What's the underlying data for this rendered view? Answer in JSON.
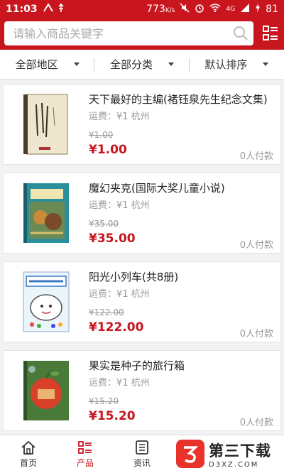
{
  "status_bar": {
    "time": "11:03",
    "speed": "773",
    "speed_unit": "K/s",
    "network": "4G",
    "battery": "81"
  },
  "search": {
    "placeholder": "请输入商品关键字"
  },
  "filters": [
    {
      "label": "全部地区"
    },
    {
      "label": "全部分类"
    },
    {
      "label": "默认排序"
    }
  ],
  "products": [
    {
      "title": "天下最好的主编(褚钰泉先生纪念文集)",
      "shipping": "运费：¥1 杭州",
      "original_price": "¥1.00",
      "price": "¥1.00",
      "paid": "0人付款"
    },
    {
      "title": "魔幻夹克(国际大奖儿童小说)",
      "shipping": "运费：¥1 杭州",
      "original_price": "¥35.00",
      "price": "¥35.00",
      "paid": "0人付款"
    },
    {
      "title": "阳光小列车(共8册)",
      "shipping": "运费：¥1 杭州",
      "original_price": "¥122.00",
      "price": "¥122.00",
      "paid": "0人付款"
    },
    {
      "title": "果实是种子的旅行箱",
      "shipping": "运费：¥1 杭州",
      "original_price": "¥15.20",
      "price": "¥15.20",
      "paid": "0人付款"
    }
  ],
  "tabbar": [
    {
      "label": "首页"
    },
    {
      "label": "产品"
    },
    {
      "label": "资讯"
    }
  ],
  "watermark": {
    "title": "第三下载",
    "domain": "D3XZ.COM"
  },
  "colors": {
    "brand": "#c9151e",
    "price": "#c9151e"
  }
}
